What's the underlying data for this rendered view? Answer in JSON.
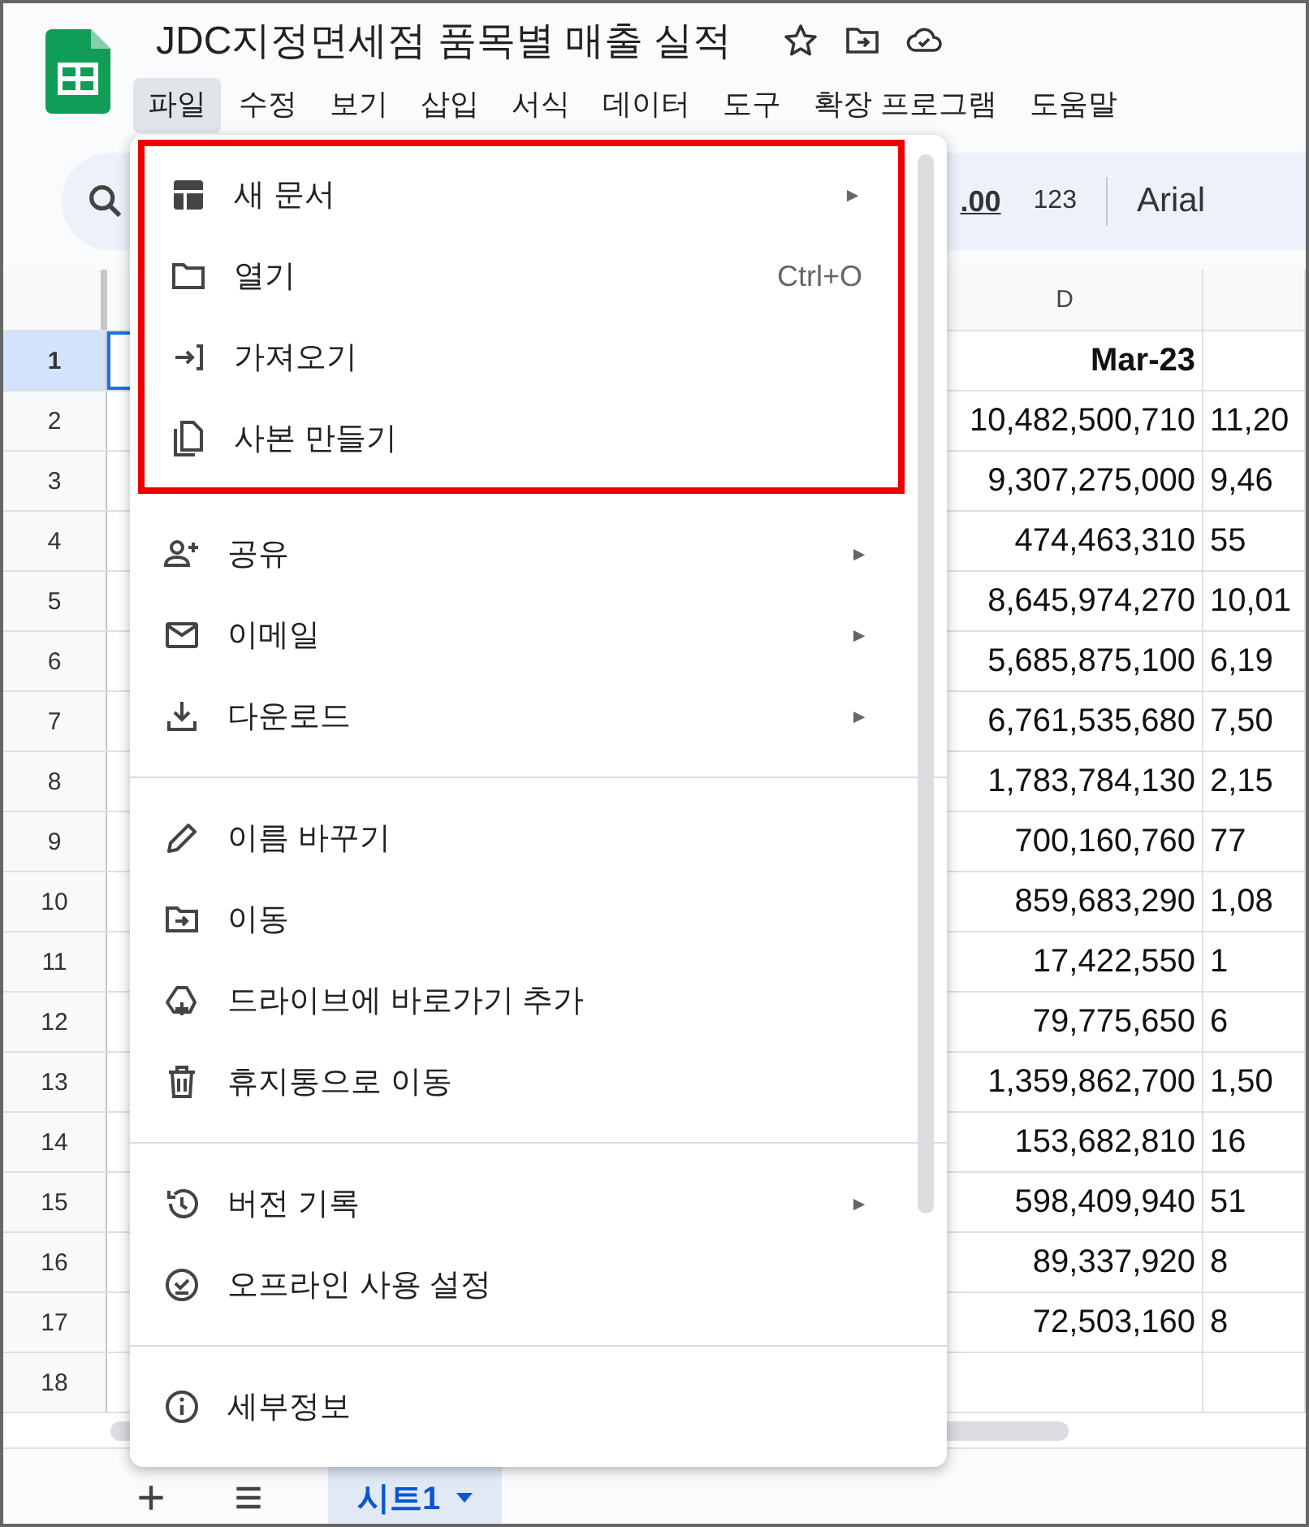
{
  "document": {
    "title": "JDC지정면세점 품목별 매출 실적"
  },
  "menubar": [
    {
      "label": "파일",
      "selected": true
    },
    {
      "label": "수정",
      "selected": false
    },
    {
      "label": "보기",
      "selected": false
    },
    {
      "label": "삽입",
      "selected": false
    },
    {
      "label": "서식",
      "selected": false
    },
    {
      "label": "데이터",
      "selected": false
    },
    {
      "label": "도구",
      "selected": false
    },
    {
      "label": "확장 프로그램",
      "selected": false
    },
    {
      "label": "도움말",
      "selected": false
    }
  ],
  "toolbar": {
    "decimal_label": ".00",
    "number_format": "123",
    "font": "Arial"
  },
  "sheet": {
    "column_header": "D",
    "rows": [
      {
        "number": "1",
        "selected": true,
        "kind": "header",
        "d": "Mar-23"
      },
      {
        "number": "2",
        "selected": false,
        "kind": "data",
        "d": "10,482,500,710",
        "e": "11,20"
      },
      {
        "number": "3",
        "selected": false,
        "kind": "data",
        "d": "9,307,275,000",
        "e": "9,46"
      },
      {
        "number": "4",
        "selected": false,
        "kind": "data",
        "d": "474,463,310",
        "e": "55"
      },
      {
        "number": "5",
        "selected": false,
        "kind": "data",
        "d": "8,645,974,270",
        "e": "10,01"
      },
      {
        "number": "6",
        "selected": false,
        "kind": "data",
        "d": "5,685,875,100",
        "e": "6,19"
      },
      {
        "number": "7",
        "selected": false,
        "kind": "data",
        "d": "6,761,535,680",
        "e": "7,50"
      },
      {
        "number": "8",
        "selected": false,
        "kind": "data",
        "d": "1,783,784,130",
        "e": "2,15"
      },
      {
        "number": "9",
        "selected": false,
        "kind": "data",
        "d": "700,160,760",
        "e": "77"
      },
      {
        "number": "10",
        "selected": false,
        "kind": "data",
        "d": "859,683,290",
        "e": "1,08"
      },
      {
        "number": "11",
        "selected": false,
        "kind": "data",
        "d": "17,422,550",
        "e": "1"
      },
      {
        "number": "12",
        "selected": false,
        "kind": "data",
        "d": "79,775,650",
        "e": "6"
      },
      {
        "number": "13",
        "selected": false,
        "kind": "data",
        "d": "1,359,862,700",
        "e": "1,50"
      },
      {
        "number": "14",
        "selected": false,
        "kind": "data",
        "d": "153,682,810",
        "e": "16"
      },
      {
        "number": "15",
        "selected": false,
        "kind": "data",
        "d": "598,409,940",
        "e": "51"
      },
      {
        "number": "16",
        "selected": false,
        "kind": "data",
        "d": "89,337,920",
        "e": "8"
      },
      {
        "number": "17",
        "selected": false,
        "kind": "data",
        "d": "72,503,160",
        "e": "8"
      },
      {
        "number": "18",
        "selected": false,
        "kind": "empty"
      }
    ],
    "tabs": [
      {
        "label": "시트1",
        "selected": true
      }
    ]
  },
  "file_menu": {
    "groups": [
      {
        "highlighted": true,
        "items": [
          {
            "label": "새 문서",
            "arrow": "►"
          },
          {
            "label": "열기",
            "shortcut": "Ctrl+O"
          },
          {
            "label": "가져오기"
          },
          {
            "label": "사본 만들기"
          }
        ]
      },
      {
        "highlighted": false,
        "items": [
          {
            "label": "공유",
            "arrow": "►"
          },
          {
            "label": "이메일",
            "arrow": "►"
          },
          {
            "label": "다운로드",
            "arrow": "►"
          }
        ]
      },
      {
        "highlighted": false,
        "items": [
          {
            "label": "이름 바꾸기"
          },
          {
            "label": "이동"
          },
          {
            "label": "드라이브에 바로가기 추가"
          },
          {
            "label": "휴지통으로 이동"
          }
        ]
      },
      {
        "highlighted": false,
        "items": [
          {
            "label": "버전 기록",
            "arrow": "►"
          },
          {
            "label": "오프라인 사용 설정"
          }
        ]
      },
      {
        "highlighted": false,
        "items": [
          {
            "label": "세부정보"
          }
        ]
      }
    ]
  }
}
